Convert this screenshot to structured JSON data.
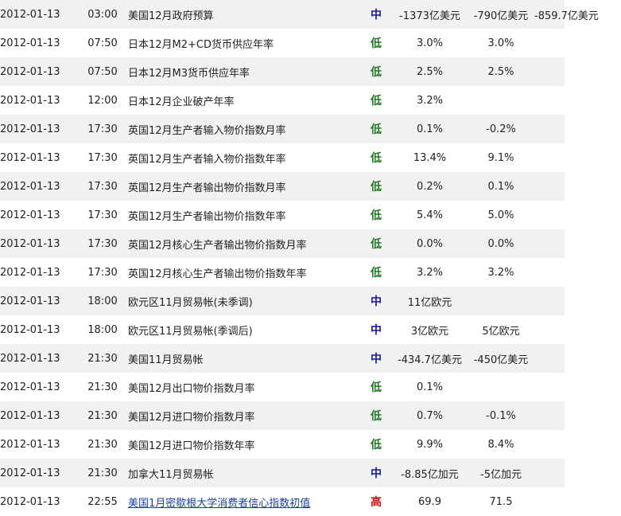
{
  "colors": {
    "mid": "#1414a8",
    "low": "#1f7a1f",
    "high": "#cc1111",
    "link": "#1a3fa8"
  },
  "rows": [
    {
      "date": "2012-01-13",
      "time": "03:00",
      "event": "美国12月政府预算",
      "importance": "中",
      "level": "mid",
      "actual": "-1373亿美元",
      "forecast": "-790亿美元",
      "previous": "-859.7亿美元"
    },
    {
      "date": "2012-01-13",
      "time": "07:50",
      "event": "日本12月M2+CD货币供应年率",
      "importance": "低",
      "level": "low",
      "actual": "3.0%",
      "forecast": "3.0%",
      "previous": ""
    },
    {
      "date": "2012-01-13",
      "time": "07:50",
      "event": "日本12月M3货币供应年率",
      "importance": "低",
      "level": "low",
      "actual": "2.5%",
      "forecast": "2.5%",
      "previous": ""
    },
    {
      "date": "2012-01-13",
      "time": "12:00",
      "event": "日本12月企业破产年率",
      "importance": "低",
      "level": "low",
      "actual": "3.2%",
      "forecast": "",
      "previous": ""
    },
    {
      "date": "2012-01-13",
      "time": "17:30",
      "event": "英国12月生产者输入物价指数月率",
      "importance": "低",
      "level": "low",
      "actual": "0.1%",
      "forecast": "-0.2%",
      "previous": ""
    },
    {
      "date": "2012-01-13",
      "time": "17:30",
      "event": "英国12月生产者输入物价指数年率",
      "importance": "低",
      "level": "low",
      "actual": "13.4%",
      "forecast": "9.1%",
      "previous": ""
    },
    {
      "date": "2012-01-13",
      "time": "17:30",
      "event": "英国12月生产者输出物价指数月率",
      "importance": "低",
      "level": "low",
      "actual": "0.2%",
      "forecast": "0.1%",
      "previous": ""
    },
    {
      "date": "2012-01-13",
      "time": "17:30",
      "event": "英国12月生产者输出物价指数年率",
      "importance": "低",
      "level": "low",
      "actual": "5.4%",
      "forecast": "5.0%",
      "previous": ""
    },
    {
      "date": "2012-01-13",
      "time": "17:30",
      "event": "英国12月核心生产者输出物价指数月率",
      "importance": "低",
      "level": "low",
      "actual": "0.0%",
      "forecast": "0.0%",
      "previous": ""
    },
    {
      "date": "2012-01-13",
      "time": "17:30",
      "event": "英国12月核心生产者输出物价指数年率",
      "importance": "低",
      "level": "low",
      "actual": "3.2%",
      "forecast": "3.2%",
      "previous": ""
    },
    {
      "date": "2012-01-13",
      "time": "18:00",
      "event": "欧元区11月贸易帐(未季调)",
      "importance": "中",
      "level": "mid",
      "actual": "11亿欧元",
      "forecast": "",
      "previous": ""
    },
    {
      "date": "2012-01-13",
      "time": "18:00",
      "event": "欧元区11月贸易帐(季调后)",
      "importance": "中",
      "level": "mid",
      "actual": "3亿欧元",
      "forecast": "5亿欧元",
      "previous": ""
    },
    {
      "date": "2012-01-13",
      "time": "21:30",
      "event": "美国11月贸易帐",
      "importance": "中",
      "level": "mid",
      "actual": "-434.7亿美元",
      "forecast": "-450亿美元",
      "previous": ""
    },
    {
      "date": "2012-01-13",
      "time": "21:30",
      "event": "美国12月出口物价指数月率",
      "importance": "低",
      "level": "low",
      "actual": "0.1%",
      "forecast": "",
      "previous": ""
    },
    {
      "date": "2012-01-13",
      "time": "21:30",
      "event": "美国12月进口物价指数月率",
      "importance": "低",
      "level": "low",
      "actual": "0.7%",
      "forecast": "-0.1%",
      "previous": ""
    },
    {
      "date": "2012-01-13",
      "time": "21:30",
      "event": "美国12月进口物价指数年率",
      "importance": "低",
      "level": "low",
      "actual": "9.9%",
      "forecast": "8.4%",
      "previous": ""
    },
    {
      "date": "2012-01-13",
      "time": "21:30",
      "event": "加拿大11月贸易帐",
      "importance": "中",
      "level": "mid",
      "actual": "-8.85亿加元",
      "forecast": "-5亿加元",
      "previous": ""
    },
    {
      "date": "2012-01-13",
      "time": "22:55",
      "event": "美国1月密歇根大学消费者信心指数初值",
      "importance": "高",
      "level": "high",
      "link": true,
      "actual": "69.9",
      "forecast": "71.5",
      "previous": ""
    }
  ]
}
